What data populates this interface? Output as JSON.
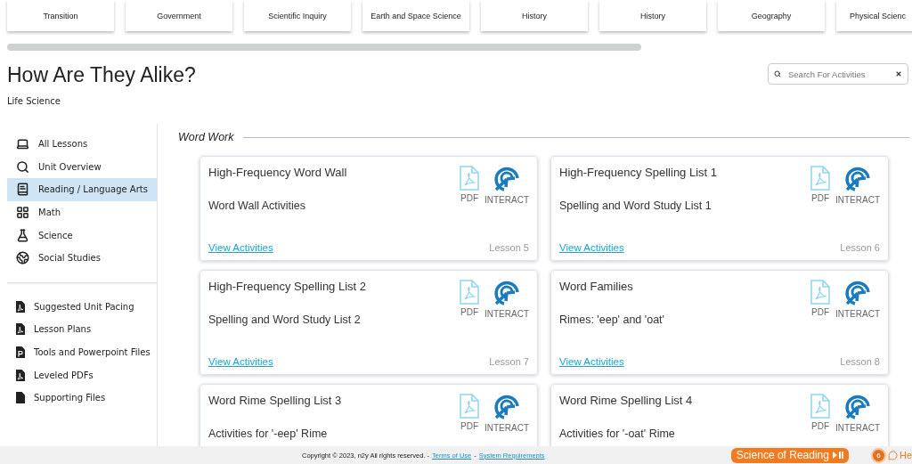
{
  "subject_tiles": [
    {
      "label": "Transition"
    },
    {
      "label": "Government"
    },
    {
      "label": "Scientific Inquiry"
    },
    {
      "label": "Earth and Space Science"
    },
    {
      "label": "History"
    },
    {
      "label": "History"
    },
    {
      "label": "Geography"
    },
    {
      "label": "Physical Scienc"
    }
  ],
  "page": {
    "title": "How Are They Alike?",
    "subtitle": "Life Science"
  },
  "search": {
    "placeholder": "Search For Activities"
  },
  "sidebar": {
    "items": [
      {
        "label": "All Lessons",
        "selected": false
      },
      {
        "label": "Unit Overview",
        "selected": false
      },
      {
        "label": "Reading / Language Arts",
        "selected": true
      },
      {
        "label": "Math",
        "selected": false
      },
      {
        "label": "Science",
        "selected": false
      },
      {
        "label": "Social Studies",
        "selected": false
      }
    ],
    "files": [
      {
        "label": "Suggested Unit Pacing",
        "kind": "pdf"
      },
      {
        "label": "Lesson Plans",
        "kind": "pdf"
      },
      {
        "label": "Tools and Powerpoint Files",
        "kind": "ppt"
      },
      {
        "label": "Leveled PDFs",
        "kind": "pdf"
      },
      {
        "label": "Supporting Files",
        "kind": "file"
      }
    ]
  },
  "section": {
    "title": "Word Work"
  },
  "cards": [
    {
      "title": "High-Frequency Word Wall",
      "subtitle": "Word Wall Activities",
      "link": "View Activities",
      "lesson": "Lesson 5",
      "pdf": "PDF",
      "interact": "INTERACT"
    },
    {
      "title": "High-Frequency Spelling List 1",
      "subtitle": "Spelling and Word Study List 1",
      "link": "View Activities",
      "lesson": "Lesson 6",
      "pdf": "PDF",
      "interact": "INTERACT"
    },
    {
      "title": "High-Frequency Spelling List 2",
      "subtitle": "Spelling and Word Study List 2",
      "link": "View Activities",
      "lesson": "Lesson 7",
      "pdf": "PDF",
      "interact": "INTERACT"
    },
    {
      "title": "Word Families",
      "subtitle": "Rimes: 'eep' and 'oat'",
      "link": "View Activities",
      "lesson": "Lesson 8",
      "pdf": "PDF",
      "interact": "INTERACT"
    },
    {
      "title": "Word Rime Spelling List 3",
      "subtitle": "Activities for '-eep' Rime",
      "pdf": "PDF",
      "interact": "INTERACT"
    },
    {
      "title": "Word Rime Spelling List 4",
      "subtitle": "Activities for '-oat' Rime",
      "pdf": "PDF",
      "interact": "INTERACT"
    }
  ],
  "footer": {
    "copyright": "Copyright © 2023, n2y All rights reserved. -",
    "terms": "Terms of Use",
    "separator": "-",
    "requirements": "System Requirements",
    "button": "Science of Reading",
    "badge": "6",
    "help": "He"
  }
}
